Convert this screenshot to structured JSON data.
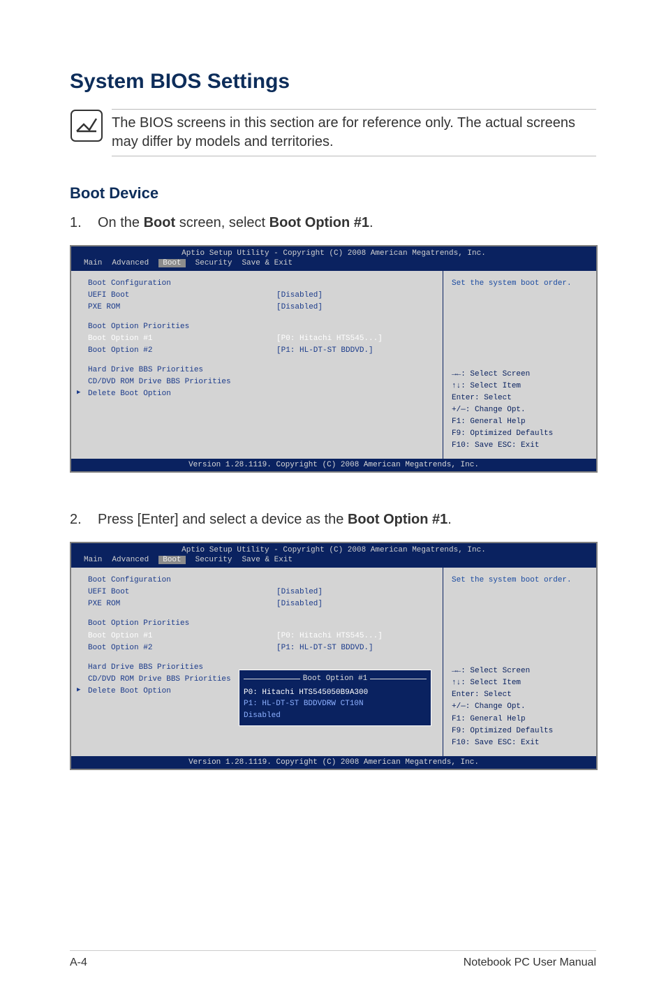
{
  "heading": "System BIOS Settings",
  "note": "The BIOS screens in this section are for reference only. The actual screens may differ by models and territories.",
  "subheading": "Boot Device",
  "step1_num": "1.",
  "step1_pre": "On the ",
  "step1_b1": "Boot",
  "step1_mid": " screen, select ",
  "step1_b2": "Boot Option #1",
  "step1_post": ".",
  "step2_num": "2.",
  "step2_pre": "Press [Enter] and select a device as the ",
  "step2_b1": "Boot Option #1",
  "step2_post": ".",
  "bios": {
    "copyright": "Aptio Setup Utility - Copyright (C) 2008 American Megatrends, Inc.",
    "tabs": {
      "main": "Main",
      "advanced": "Advanced",
      "boot": "Boot",
      "security": "Security",
      "save": "Save & Exit"
    },
    "version": "Version 1.28.1119. Copyright (C) 2008 American Megatrends, Inc.",
    "help_top": "Set the system boot order.",
    "left": {
      "boot_conf": "Boot Configuration",
      "uefi": "UEFI Boot",
      "uefi_v": "[Disabled]",
      "pxe": "PXE ROM",
      "pxe_v": "[Disabled]",
      "prio": "Boot Option Priorities",
      "o1": "Boot Option #1",
      "o1_v": "[P0: Hitachi HTS545...]",
      "o2": "Boot Option #2",
      "o2_v": "[P1: HL-DT-ST BDDVD.]",
      "hdd": "Hard Drive BBS Priorities",
      "cd": "CD/DVD ROM Drive BBS Priorities",
      "del": "Delete Boot Option"
    },
    "keys": {
      "k1": "→←: Select Screen",
      "k2": "↑↓:    Select Item",
      "k3": "Enter: Select",
      "k4": "+/—:  Change Opt.",
      "k5": "F1:    General Help",
      "k6": "F9:    Optimized Defaults",
      "k7": "F10:  Save    ESC: Exit"
    }
  },
  "popup": {
    "title": "Boot Option #1",
    "o1": "P0: Hitachi HTS545050B9A300",
    "o2": "P1: HL-DT-ST BDDVDRW CT10N",
    "o3": "Disabled"
  },
  "footer_left": "A-4",
  "footer_right": "Notebook PC User Manual"
}
